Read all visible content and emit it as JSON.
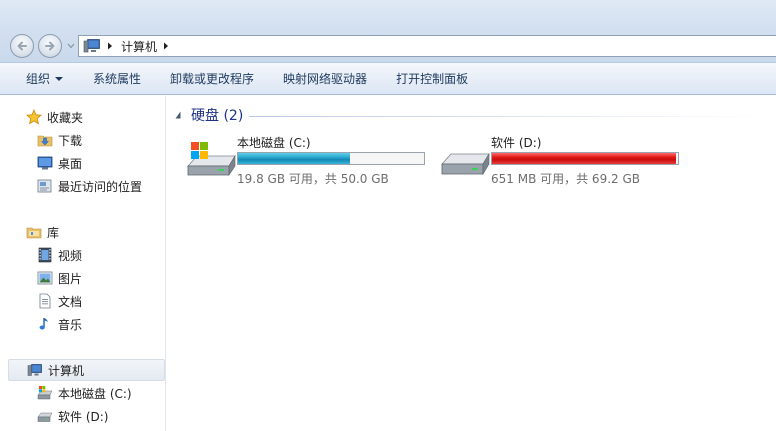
{
  "address": {
    "crumbs": [
      "计算机"
    ]
  },
  "toolbar": {
    "organize": "组织",
    "system_properties": "系统属性",
    "uninstall_change": "卸载或更改程序",
    "map_network_drive": "映射网络驱动器",
    "open_control_panel": "打开控制面板"
  },
  "nav": {
    "favorites": {
      "label": "收藏夹",
      "items": [
        {
          "label": "下载",
          "icon": "downloads-folder-icon"
        },
        {
          "label": "桌面",
          "icon": "desktop-icon"
        },
        {
          "label": "最近访问的位置",
          "icon": "recent-places-icon"
        }
      ]
    },
    "libraries": {
      "label": "库",
      "items": [
        {
          "label": "视频",
          "icon": "videos-library-icon"
        },
        {
          "label": "图片",
          "icon": "pictures-library-icon"
        },
        {
          "label": "文档",
          "icon": "documents-library-icon"
        },
        {
          "label": "音乐",
          "icon": "music-library-icon"
        }
      ]
    },
    "computer": {
      "label": "计算机",
      "items": [
        {
          "label": "本地磁盘 (C:)",
          "icon": "system-drive-icon"
        },
        {
          "label": "软件 (D:)",
          "icon": "drive-icon"
        }
      ]
    }
  },
  "content": {
    "group_title": "硬盘 (2)",
    "drives": [
      {
        "name": "本地磁盘 (C:)",
        "info": "19.8 GB 可用，共 50.0 GB",
        "used_fraction": 0.604,
        "bar_color": "blue"
      },
      {
        "name": "软件 (D:)",
        "info": "651 MB 可用，共 69.2 GB",
        "used_fraction": 0.99,
        "bar_color": "red"
      }
    ]
  },
  "colors": {
    "group_title": "#1e3287",
    "usage_blue": "#2aa7cc",
    "usage_red": "#e01616"
  }
}
